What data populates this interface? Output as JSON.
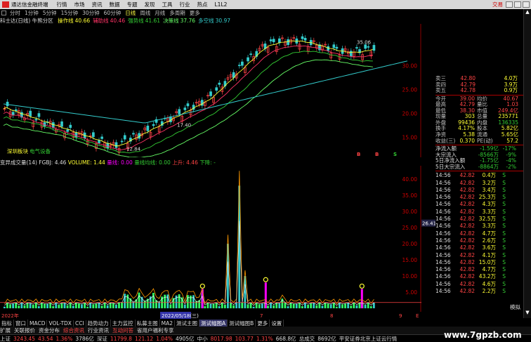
{
  "app": {
    "title": "通达信金融终端",
    "brand": "交易"
  },
  "menu": [
    "行情",
    "市场",
    "资讯",
    "数据",
    "专题",
    "发现",
    "工具",
    "行业",
    "热点",
    "L1L2"
  ],
  "periods": [
    "分时",
    "1分钟",
    "5分钟",
    "15分钟",
    "30分钟",
    "60分钟",
    "日线",
    "周线",
    "月线",
    "多周期",
    "更多"
  ],
  "active_period": "日线",
  "stock": {
    "name": "科士达(日线)",
    "indicator": "牛熊分区"
  },
  "ma_legend": [
    {
      "label": "操作线",
      "value": "40.66",
      "color": "#ffff33"
    },
    {
      "label": "辅助线",
      "value": "40.46",
      "color": "#ff3366"
    },
    {
      "label": "强势线",
      "value": "41.61",
      "color": "#33cc33"
    },
    {
      "label": "决策线",
      "value": "37.76",
      "color": "#66ff66"
    },
    {
      "label": "多空线",
      "value": "30.97",
      "color": "#33cccc"
    }
  ],
  "price_axis": [
    "30.00",
    "25.00",
    "20.00",
    "15.00"
  ],
  "annotations": {
    "high": "35.06",
    "low": "12.84",
    "mid": "17.40",
    "mark1": "深圳板块",
    "mark2": "电气设备",
    "signals": [
      "B",
      "B",
      "S"
    ]
  },
  "sub_legend": {
    "name": "变异成交量(14)",
    "fgbj": "FGBJ: 4.46",
    "volume": "VOLUME: 1.44",
    "l1": "量线: 0.00",
    "l2": "量线均线: 0.00",
    "l3": "上升: 4.46",
    "l4": "下降: -"
  },
  "vol_axis": [
    "40.00",
    "35.00",
    "30.00",
    "25.00",
    "20.00",
    "15.00",
    "10.00",
    "5.00"
  ],
  "vol_marker": "26.41",
  "date_axis": {
    "left": "2022年",
    "selected": "2022/05/18(三)",
    "m1": "7",
    "m2": "8",
    "m3": "9",
    "right": "E"
  },
  "tabs": [
    "指标",
    "窗口",
    "MACD",
    "VOL-TDX",
    "CCI",
    "趋势动力",
    "主力监控",
    "私募主图",
    "MA2",
    "测试主图",
    "测试幅图A",
    "测试幅图B",
    "更多",
    "设置"
  ],
  "active_tab": "测试幅图A",
  "toolbar2": [
    "扩展",
    "关联报价",
    "资金分布",
    "综合资讯",
    "行业资讯",
    "互动问答",
    "省用户福利专享"
  ],
  "status": {
    "sh_label": "上证",
    "sh_val": "3243.45",
    "sh_chg": "43.54",
    "sh_pct": "1.36%",
    "sh_amt": "3786亿",
    "sz_label": "深证",
    "sz_val": "11799.8",
    "sz_chg": "121.12",
    "sz_pct": "1.04%",
    "sz_amt": "4905亿",
    "zx_label": "中小",
    "zx_val": "8017.98",
    "zx_chg": "103.77",
    "zx_pct": "1.31%",
    "zx_amt": "668.8亿",
    "zc_label": "总成交",
    "zc_val": "8692亿",
    "info": "平安证券北京上证云行情"
  },
  "quote": {
    "asks": [
      {
        "k": "卖三",
        "p": "42.80",
        "v": "4.0万"
      },
      {
        "k": "卖四",
        "p": "42.79",
        "v": "3.9万"
      },
      {
        "k": "卖五",
        "p": "42.78",
        "v": "0.9万"
      }
    ],
    "stats": [
      {
        "k1": "今开",
        "v1": "39.00",
        "k2": "均价",
        "v2": "40.67"
      },
      {
        "k1": "最高",
        "v1": "42.79",
        "k2": "量比",
        "v2": "1.03"
      },
      {
        "k1": "最低",
        "v1": "38.30",
        "k2": "市值",
        "v2": "249.4亿"
      },
      {
        "k1": "现量",
        "v1": "303",
        "k2": "总量",
        "v2": "235771"
      },
      {
        "k1": "外盘",
        "v1": "99436",
        "k2": "内盘",
        "v2": "136335"
      },
      {
        "k1": "换手",
        "v1": "4.17%",
        "k2": "股本",
        "v2": "5.82亿"
      },
      {
        "k1": "净资",
        "v1": "5.38",
        "k2": "流通",
        "v2": "5.65亿"
      },
      {
        "k1": "收益(三)",
        "v1": "0.370",
        "k2": "PE(动)",
        "v2": "57.2"
      }
    ],
    "flows": [
      {
        "k": "净流入额",
        "v": "-1.59亿",
        "p": "-17%"
      },
      {
        "k": "大宗流入",
        "v": "-8566万",
        "p": "-9%"
      },
      {
        "k": "5日净流入额",
        "v": "-1.75亿",
        "p": "-4%"
      },
      {
        "k": "5日大宗流入",
        "v": "-8864万",
        "p": "-2%"
      }
    ],
    "ticks": [
      {
        "t": "14:56",
        "p": "42.82",
        "v": "0.4万",
        "s": "S"
      },
      {
        "t": "14:56",
        "p": "42.82",
        "v": "3.2万",
        "s": "S"
      },
      {
        "t": "14:56",
        "p": "42.82",
        "v": "3.4万",
        "s": "S"
      },
      {
        "t": "14:56",
        "p": "42.82",
        "v": "25.3万",
        "s": "S"
      },
      {
        "t": "14:56",
        "p": "42.82",
        "v": "4.3万",
        "s": "S"
      },
      {
        "t": "14:56",
        "p": "42.82",
        "v": "3.3万",
        "s": "S"
      },
      {
        "t": "14:56",
        "p": "42.82",
        "v": "32.5万",
        "s": "S"
      },
      {
        "t": "14:56",
        "p": "42.82",
        "v": "3.3万",
        "s": "S"
      },
      {
        "t": "14:56",
        "p": "42.82",
        "v": "4.7万",
        "s": "S"
      },
      {
        "t": "14:56",
        "p": "42.82",
        "v": "2.6万",
        "s": "S"
      },
      {
        "t": "14:56",
        "p": "42.82",
        "v": "3.6万",
        "s": "S"
      },
      {
        "t": "14:56",
        "p": "42.82",
        "v": "4.1万",
        "s": "S"
      },
      {
        "t": "14:56",
        "p": "42.82",
        "v": "15.0万",
        "s": "S"
      },
      {
        "t": "14:56",
        "p": "42.82",
        "v": "4.7万",
        "s": "S"
      },
      {
        "t": "14:56",
        "p": "42.82",
        "v": "43.2万",
        "s": "S"
      },
      {
        "t": "14:56",
        "p": "42.82",
        "v": "4.6万",
        "s": "S"
      },
      {
        "t": "14:56",
        "p": "42.82",
        "v": "2.2万",
        "s": "S"
      }
    ]
  },
  "side_labels": {
    "tick_label": "模拟",
    "watermark": "www.7gpzb.com"
  }
}
